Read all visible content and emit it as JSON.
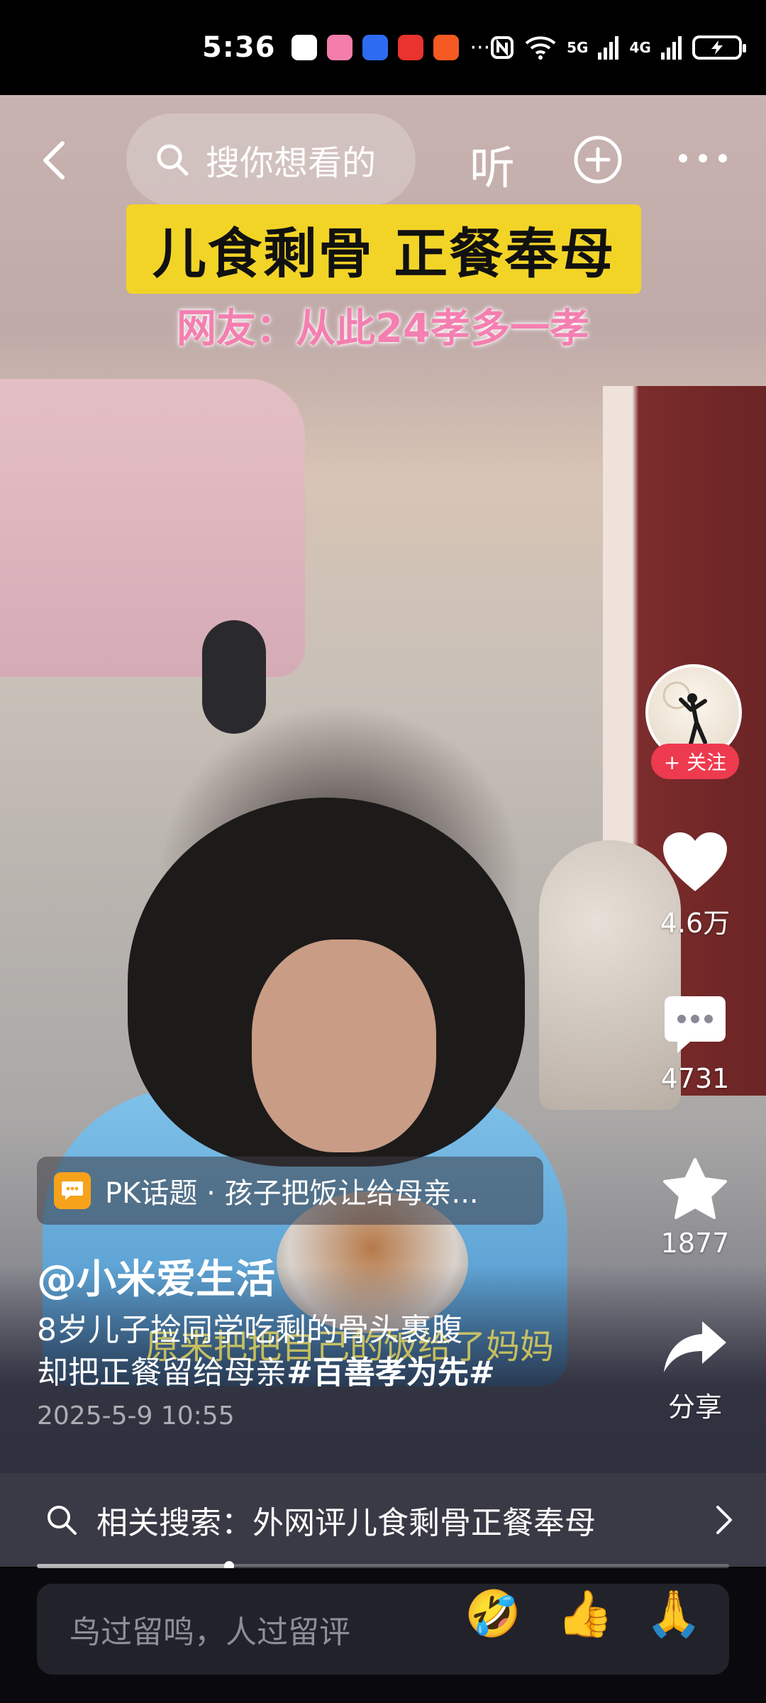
{
  "status_bar": {
    "time": "5:36",
    "more": "···",
    "network": "5G",
    "network2": "4G"
  },
  "top_nav": {
    "search_placeholder": "搜你想看的",
    "listen_label": "听"
  },
  "video": {
    "headline": "儿食剩骨 正餐奉母",
    "subheadline": "网友：从此24孝多一孝",
    "burned_subtitle": "原来把把自己的饭给了妈妈"
  },
  "side_actions": {
    "follow_label": "+ 关注",
    "likes": "4.6万",
    "comments": "4731",
    "favorites": "1877",
    "share_label": "分享"
  },
  "post": {
    "topic": "PK话题 · 孩子把饭让给母亲...",
    "author": "@小米爱生活",
    "caption_line1": "8岁儿子捡同学吃剩的骨头裹腹",
    "caption_line2": "却把正餐留给母亲",
    "caption_tag": "#百善孝为先#",
    "timestamp": "2025-5-9 10:55"
  },
  "related_search": {
    "label": "相关搜索：外网评儿食剩骨正餐奉母"
  },
  "playback": {
    "progress_fraction": 0.278
  },
  "comment_bar": {
    "placeholder": "鸟过留鸣，人过留评",
    "emoji1": "🤣",
    "emoji2": "👍",
    "emoji3": "🙏"
  }
}
